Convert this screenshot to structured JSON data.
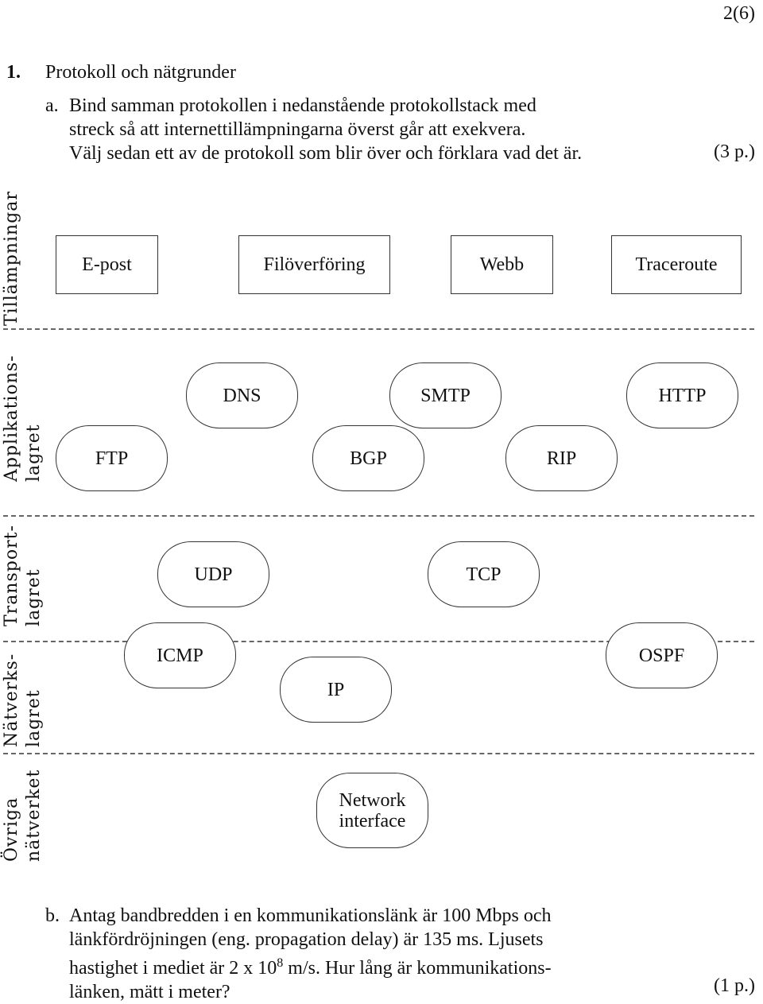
{
  "page_number": "2(6)",
  "question": {
    "number": "1.",
    "title": "Protokoll och nätgrunder"
  },
  "part_a": {
    "label": "a.",
    "lines": [
      "Bind samman protokollen i nedanstående protokollstack med",
      "streck så att internettillämpningarna överst går att exekvera.",
      "Välj sedan ett av de protokoll som blir över och förklara vad det är."
    ],
    "points": "(3 p.)"
  },
  "layers": {
    "applications": "Tillämpningar",
    "application_layer": [
      "Applikations-",
      "lagret"
    ],
    "transport_layer": [
      "Transport-",
      "lagret"
    ],
    "network_layer": [
      "Nätverks-",
      "lagret"
    ],
    "rest_of_network": [
      "Övriga",
      "nätverket"
    ]
  },
  "applications": [
    "E-post",
    "Filöverföring",
    "Webb",
    "Traceroute"
  ],
  "protocols": {
    "dns": "DNS",
    "smtp": "SMTP",
    "http": "HTTP",
    "ftp": "FTP",
    "bgp": "BGP",
    "rip": "RIP",
    "udp": "UDP",
    "tcp": "TCP",
    "icmp": "ICMP",
    "ospf": "OSPF",
    "ip": "IP",
    "network_interface": [
      "Network",
      "interface"
    ]
  },
  "part_b": {
    "label": "b.",
    "line1": "Antag bandbredden i en kommunikationslänk är 100 Mbps och",
    "line2": "länkfördröjningen (eng. propagation delay) är 135 ms. Ljusets",
    "line3_pre": "hastighet i mediet är 2 x 10",
    "line3_exp": "8",
    "line3_post": " m/s. Hur lång är kommunikations-",
    "line4": "länken, mätt i meter?",
    "points": "(1 p.)"
  }
}
